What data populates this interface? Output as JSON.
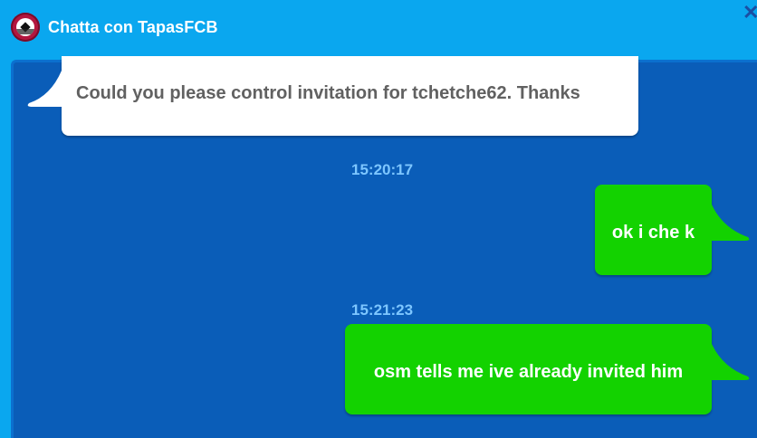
{
  "header": {
    "title": "Chatta con TapasFCB",
    "avatar_icon": "soccer-ball-icon",
    "close_icon": "close-icon"
  },
  "messages": [
    {
      "direction": "incoming",
      "text": "Could you please control invitation for tchetche62. Thanks"
    },
    {
      "direction": "outgoing",
      "time": "15:20:17",
      "text": "ok i che k"
    },
    {
      "direction": "outgoing",
      "time": "15:21:23",
      "text": "osm tells me ive already invited him"
    }
  ],
  "colors": {
    "header_bg": "#0aa7ef",
    "panel_bg": "#0a5db8",
    "incoming_bubble": "#ffffff",
    "outgoing_bubble": "#13d200",
    "timestamp": "#7dc6ff"
  }
}
